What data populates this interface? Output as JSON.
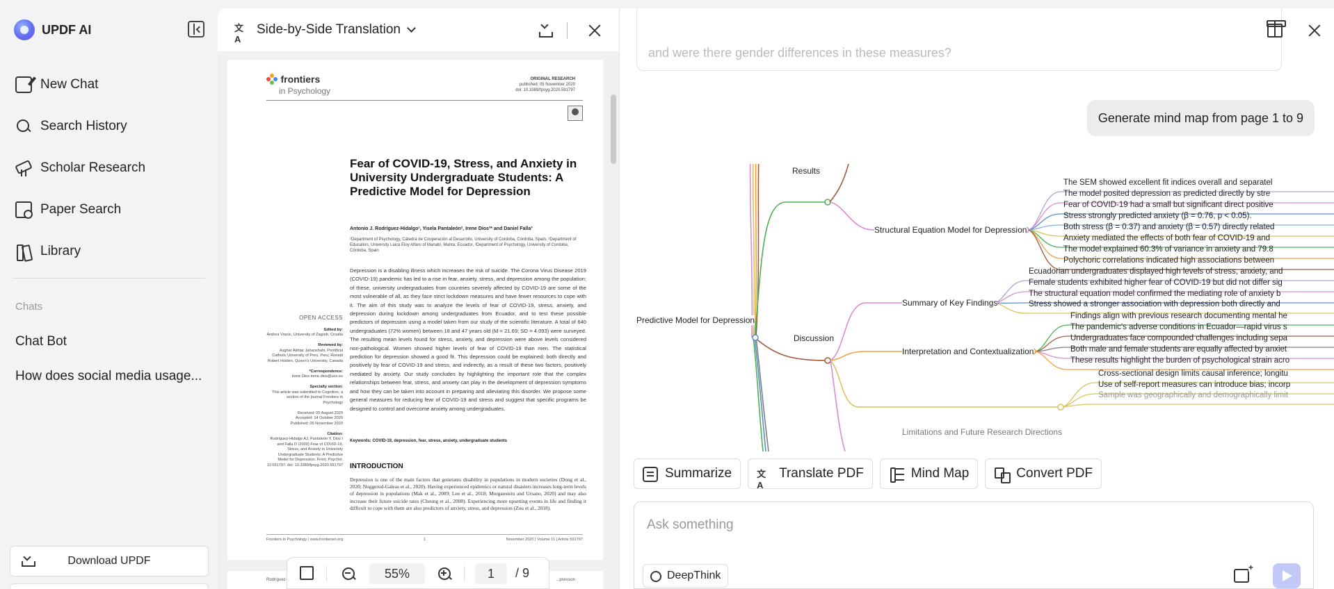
{
  "sidebar": {
    "app_name": "UPDF AI",
    "nav": [
      {
        "label": "New Chat",
        "icon": "new-chat-icon"
      },
      {
        "label": "Search History",
        "icon": "search-icon"
      },
      {
        "label": "Scholar Research",
        "icon": "telescope-icon"
      },
      {
        "label": "Paper Search",
        "icon": "paper-search-icon"
      },
      {
        "label": "Library",
        "icon": "library-icon"
      }
    ],
    "chats_title": "Chats",
    "chats": [
      "Chat Bot",
      "How does social media usage..."
    ],
    "download_label": "Download UPDF"
  },
  "translation": {
    "title": "Side-by-Side Translation",
    "pdf": {
      "journal_1": "frontiers",
      "journal_2": "in Psychology",
      "article_type": "ORIGINAL RESEARCH",
      "published": "published: 05 November 2020",
      "doi": "doi: 10.3389/fpsyg.2020.591797",
      "title": "Fear of COVID-19, Stress, and Anxiety in University Undergraduate Students: A Predictive Model for Depression",
      "authors": "Antonio J. Rodríguez-Hidalgo¹, Yisela Pantaleón², Irene Dios³* and Daniel Falla³",
      "affiliations": "¹Department of Psychology, Cátedra de Cooperación al Desarrollo, University of Cordoba, Córdoba, Spain, ²Department of Education, University Laica Eloy Alfaro of Manabí, Manta, Ecuador, ³Department of Psychology, University of Cordoba, Córdoba, Spain",
      "abstract": "Depression is a disabling illness which increases the risk of suicide. The Corona Virus Disease 2019 (COVID-19) pandemic has led to a rise in fear, anxiety, stress, and depression among the population; of these, university undergraduates from countries severely affected by COVID-19 are some of the most vulnerable of all, as they face strict lockdown measures and have fewer resources to cope with it. The aim of this study was to analyze the levels of fear of COVID-19, stress, anxiety, and depression during lockdown among undergraduates from Ecuador, and to test these possible predictors of depression using a model taken from our study of the scientific literature. A total of 640 undergraduates (72% women) between 18 and 47 years old (M = 21.69; SD = 4.093) were surveyed. The resulting mean levels found for stress, anxiety, and depression were above levels considered non-pathological. Women showed higher levels of fear of COVID-19 than men. The statistical prediction for depression showed a good fit. This depression could be explained: both directly and positively by fear of COVID-19 and stress, and indirectly, as a result of these two factors, positively mediated by anxiety. Our study concludes by highlighting the important role that the complex relationships between fear, stress, and anxiety can play in the development of depression symptoms and how they can be taken into account in preparing and alleviating this disorder. We propose some general measures for reducing fear of COVID-19 and stress and suggest that specific programs be designed to control and overcome anxiety among undergraduates.",
      "keywords": "Keywords: COVID-19, depression, fear, stress, anxiety, undergraduate students",
      "intro_heading": "INTRODUCTION",
      "intro_text": "Depression is one of the main factors that generates disability in populations in modern societies (Dong et al., 2020; Nuggerud-Galeas et al., 2020). Having experienced epidemics or natural disasters increases long-term levels of depression in populations (Mak et al., 2009; Lee et al., 2018; Morganstein and Ursano, 2020) and may also increase their future suicide rates (Cheung et al., 2008). Experiencing more upsetting events in life and finding it difficult to cope with them are also predictors of anxiety, stress, and depression (Zou et al., 2018).",
      "open_access": "OPEN ACCESS",
      "edited_by_label": "Edited by:",
      "edited_by": "Andrea Vranic, University of Zagreb, Croatia",
      "reviewed_by_label": "Reviewed by:",
      "reviewed_by": "Asghar Akhtar Jahanshahi, Pontifical Catholic University of Peru, Peru; Ronald Robert Holden, Queen's University, Canada",
      "correspondence_label": "*Correspondence:",
      "correspondence": "Irene Dios irene.dios@uco.es",
      "specialty_label": "Specialty section:",
      "specialty": "This article was submitted to Cognition, a section of the journal Frontiers in Psychology",
      "received": "Received: 05 August 2020",
      "accepted": "Accepted: 14 October 2020",
      "published_date": "Published: 05 November 2020",
      "citation_label": "Citation:",
      "citation": "Rodríguez-Hidalgo AJ, Pantaleón Y, Dios I and Falla D (2020) Fear of COVID-19, Stress, and Anxiety in University Undergraduate Students: A Predictive Model for Depression. Front. Psychol. 11:591797. doi: 10.3389/fpsyg.2020.591797",
      "footer_left": "Frontiers in Psychology | www.frontiersin.org",
      "footer_mid": "1",
      "footer_right": "November 2020 | Volume 11 | Article 591797",
      "page2_snippet": "Rodríguez-H...",
      "page2_right": "...pression"
    },
    "zoom": "55%",
    "page_current": "1",
    "page_total": "/ 9"
  },
  "chat": {
    "prev_message": "and were there gender differences in these measures?",
    "user_message": "Generate mind map from page 1 to 9",
    "mindmap": {
      "root": "Predictive Model for Depression",
      "results": "Results",
      "sem": "Structural Equation Model for Depression",
      "sem_leaves": [
        "The SEM showed excellent fit indices overall and separatel",
        "The model posited depression as predicted directly by stre",
        "Fear of COVID-19 had a small but significant direct positive",
        "Stress strongly predicted anxiety (β = 0.76, p < 0.05).",
        "Both stress (β = 0.37) and anxiety (β = 0.57) directly related",
        "Anxiety mediated the effects of both fear of COVID-19 and",
        "The model explained 60.3% of variance in anxiety and 79.8",
        "Polychoric correlations indicated high associations between"
      ],
      "discussion": "Discussion",
      "summary": "Summary of Key Findings",
      "summary_leaves": [
        "Ecuadorian undergraduates displayed high levels of stress, anxiety, and",
        "Female students exhibited higher fear of COVID-19 but did not differ sig",
        "The structural equation model confirmed the mediating role of anxiety b",
        "Stress showed a stronger association with depression both directly and"
      ],
      "interp": "Interpretation and Contextualization",
      "interp_leaves": [
        "Findings align with previous research documenting mental he",
        "The pandemic's adverse conditions in Ecuador—rapid virus s",
        "Undergraduates face compounded challenges including sepa",
        "Both male and female students are equally affected by anxiet",
        "These results highlight the burden of psychological strain acro"
      ],
      "limits": "Limitations and Future Research Directions",
      "limits_leaves": [
        "Cross-sectional design limits causal inference; longitu",
        "Use of self-report measures can introduce bias; incorp",
        "Sample was geographically and demographically limit"
      ]
    },
    "actions": [
      {
        "label": "Summarize",
        "icon": "summarize-icon"
      },
      {
        "label": "Translate PDF",
        "icon": "translate-icon"
      },
      {
        "label": "Mind Map",
        "icon": "mind-map-icon"
      },
      {
        "label": "Convert PDF",
        "icon": "convert-icon"
      }
    ],
    "input_placeholder": "Ask something",
    "deepthink_label": "DeepThink"
  },
  "colors": {
    "accent": "#5e6cf2",
    "send_disabled": "#c3c9f7",
    "branch_green": "#4caf50",
    "branch_pink": "#d98ccf",
    "branch_orange": "#f0a040",
    "branch_yellow": "#d8c25a",
    "branch_brown": "#a05a40"
  }
}
